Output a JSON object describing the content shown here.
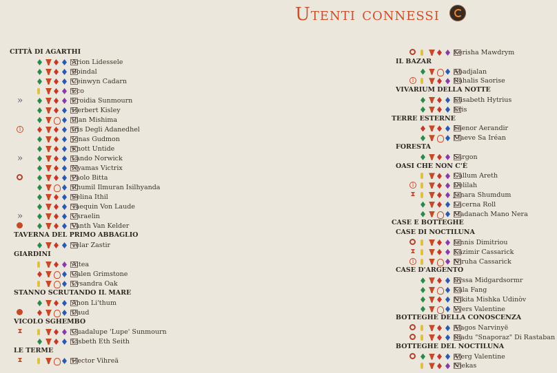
{
  "title": "Utenti connessi",
  "left": [
    {
      "location": "Città di Agarthi",
      "users": [
        {
          "name": "Arion Lidessele",
          "status": "",
          "icons": [
            "dgreen",
            "gob",
            "dred",
            "dblue"
          ]
        },
        {
          "name": "Boindal",
          "status": "",
          "icons": [
            "dgreen",
            "gob",
            "dred",
            "dblue"
          ]
        },
        {
          "name": "Ceinwyn Cadarn",
          "status": "",
          "icons": [
            "dgreen",
            "gob",
            "dred",
            "dblue"
          ]
        },
        {
          "name": "Eco",
          "status": "",
          "icons": [
            "dyellow",
            "gob",
            "dred",
            "dpurple"
          ]
        },
        {
          "name": "Eroidia Sunmourn",
          "status": "raquo",
          "icons": [
            "dgreen",
            "gob",
            "dred",
            "dpurple"
          ]
        },
        {
          "name": "Herbert Kisley",
          "status": "",
          "icons": [
            "dgreen",
            "gob",
            "dred",
            "dblue"
          ]
        },
        {
          "name": "Ilian Mishima",
          "status": "",
          "icons": [
            "dgreen",
            "gob",
            "dmg",
            "dblue"
          ]
        },
        {
          "name": "Iris Degli Adanedhel",
          "status": "info",
          "icons": [
            "dred",
            "gob",
            "dred",
            "dblue"
          ]
        },
        {
          "name": "Jonas Gudmon",
          "status": "",
          "icons": [
            "dgreen",
            "gob",
            "dred",
            "dblue"
          ]
        },
        {
          "name": "Knott Untide",
          "status": "",
          "icons": [
            "dgreen",
            "gob",
            "dred",
            "dblue"
          ]
        },
        {
          "name": "Lando Norwick",
          "status": "raquo",
          "icons": [
            "dgreen",
            "gob",
            "dred",
            "dblue"
          ]
        },
        {
          "name": "Nyamas Victrix",
          "status": "",
          "icons": [
            "dgreen",
            "gob",
            "dred",
            "dblue"
          ]
        },
        {
          "name": "Paolo Bitta",
          "status": "ring",
          "icons": [
            "dgreen",
            "gob",
            "dred",
            "dblue"
          ]
        },
        {
          "name": "Rhumil Ilmuran Isilhyanda",
          "status": "",
          "icons": [
            "dgreen",
            "gob",
            "dmg",
            "dblue"
          ]
        },
        {
          "name": "Selina Ithil",
          "status": "",
          "icons": [
            "dgreen",
            "gob",
            "dred",
            "dblue"
          ]
        },
        {
          "name": "Taequin Von Laude",
          "status": "",
          "icons": [
            "dgreen",
            "gob",
            "dred",
            "dblue"
          ]
        },
        {
          "name": "Usraelin",
          "status": "raquo",
          "icons": [
            "dgreen",
            "gob",
            "dred",
            "dblue"
          ]
        },
        {
          "name": "Vanth Van Kelder",
          "status": "red",
          "icons": [
            "dgreen",
            "gob",
            "dred",
            "dblue"
          ]
        }
      ]
    },
    {
      "location": "Taverna del Primo Abbaglio",
      "users": [
        {
          "name": "Telar Zastir",
          "status": "",
          "icons": [
            "dgreen",
            "gob",
            "dred",
            "dblue"
          ]
        }
      ]
    },
    {
      "location": "Giardini",
      "users": [
        {
          "name": "Altea",
          "status": "",
          "icons": [
            "dyellow",
            "gob",
            "dred",
            "dpurple"
          ]
        },
        {
          "name": "Galen Grimstone",
          "status": "",
          "icons": [
            "dred",
            "gob",
            "dmg",
            "dblue"
          ]
        },
        {
          "name": "Lysandra Oak",
          "status": "",
          "icons": [
            "dyellow",
            "gob",
            "dmg",
            "dblue"
          ]
        }
      ]
    },
    {
      "location": "Stanno scrutando il mare",
      "users": [
        {
          "name": "Anon Li'thum",
          "status": "",
          "icons": [
            "dgreen",
            "gob",
            "dred",
            "dblue"
          ]
        },
        {
          "name": "Daud",
          "status": "red",
          "icons": [
            "dred",
            "gob",
            "dmg",
            "dblue"
          ]
        }
      ]
    },
    {
      "location": "Vicolo Sghembo",
      "users": [
        {
          "name": "Guadalupe 'Lupe' Sunmourn",
          "status": "hg",
          "icons": [
            "dyellow",
            "gob",
            "dred",
            "dpurple"
          ]
        },
        {
          "name": "Lisbeth Eth Seith",
          "status": "",
          "icons": [
            "dgreen",
            "gob",
            "dred",
            "dblue"
          ]
        }
      ]
    },
    {
      "location": "Le Terme",
      "users": [
        {
          "name": "Hector Vihreä",
          "status": "hg",
          "icons": [
            "dyellow",
            "gob",
            "dmg",
            "dblue"
          ]
        }
      ]
    }
  ],
  "right": [
    {
      "location": "",
      "users": [
        {
          "name": "Kerisha Mawdrym",
          "status": "ring",
          "icons": [
            "dyellow",
            "gob",
            "dred",
            "dpurple"
          ]
        }
      ]
    },
    {
      "location": "Il Bazar",
      "users": [
        {
          "name": "Abadjalan",
          "status": "",
          "icons": [
            "dgreen",
            "gob",
            "dmg",
            "dblue"
          ]
        },
        {
          "name": "Rahalis Saorise",
          "status": "info",
          "icons": [
            "dyellow",
            "gob",
            "dred",
            "dpurple"
          ]
        }
      ]
    },
    {
      "location": "Vivarium della Notte",
      "users": [
        {
          "name": "Elisabeth Hytrius",
          "status": "",
          "icons": [
            "dgreen",
            "gob",
            "dred",
            "dblue"
          ]
        },
        {
          "name": "Eris",
          "status": "",
          "icons": [
            "dgreen",
            "gob",
            "dred",
            "dblue"
          ]
        }
      ]
    },
    {
      "location": "Terre Esterne",
      "users": [
        {
          "name": "Faenor Aerandir",
          "status": "",
          "icons": [
            "dred",
            "gob",
            "dred",
            "dblue"
          ]
        },
        {
          "name": "Maeve Sa Iréan",
          "status": "",
          "icons": [
            "dgreen",
            "gob",
            "dmg",
            "dblue"
          ]
        }
      ]
    },
    {
      "location": "Foresta",
      "users": [
        {
          "name": "Sargon",
          "status": "",
          "icons": [
            "dgreen",
            "gob",
            "dred",
            "dpurple"
          ]
        }
      ]
    },
    {
      "location": "Oasi che non c'è",
      "users": [
        {
          "name": "Callum Areth",
          "status": "",
          "icons": [
            "dyellow",
            "gob",
            "dred",
            "dpurple"
          ]
        },
        {
          "name": "Delilah",
          "status": "info",
          "icons": [
            "dyellow",
            "gob",
            "dred",
            "dpurple"
          ]
        },
        {
          "name": "Janara Shumdum",
          "status": "hg",
          "icons": [
            "dyellow",
            "gob",
            "dred",
            "dpurple"
          ]
        },
        {
          "name": "Lacerna Roll",
          "status": "",
          "icons": [
            "dgreen",
            "gob",
            "dred",
            "dblue"
          ]
        },
        {
          "name": "Madanach Mano Nera",
          "status": "",
          "icons": [
            "dgreen",
            "gob",
            "dmg",
            "dblue"
          ]
        }
      ]
    },
    {
      "location": "Case e Botteghe",
      "users": []
    },
    {
      "location": "Case di Noctiluna",
      "users": [
        {
          "name": "Iannis Dimitriou",
          "status": "ring",
          "icons": [
            "dyellow",
            "gob",
            "dred",
            "dpurple"
          ]
        },
        {
          "name": "Kazimir Cassarick",
          "status": "hg",
          "icons": [
            "dyellow",
            "gob",
            "dred",
            "dpurple"
          ]
        },
        {
          "name": "Niruha Cassarick",
          "status": "info",
          "icons": [
            "dyellow",
            "gob",
            "dmg",
            "dpurple"
          ]
        }
      ]
    },
    {
      "location": "Case d'Argento",
      "users": [
        {
          "name": "Ilyssa Midgardsormr",
          "status": "",
          "icons": [
            "dgreen",
            "gob",
            "dred",
            "dblue"
          ]
        },
        {
          "name": "Kala Fang",
          "status": "",
          "icons": [
            "dgreen",
            "gob",
            "dmg",
            "dblue"
          ]
        },
        {
          "name": "Nikita Mishka Udinòv",
          "status": "",
          "icons": [
            "dgreen",
            "gob",
            "dred",
            "dblue"
          ]
        },
        {
          "name": "Vyers Valentine",
          "status": "",
          "icons": [
            "dgreen",
            "gob",
            "dmg",
            "dblue"
          ]
        }
      ]
    },
    {
      "location": "Botteghe della Conoscenza",
      "users": [
        {
          "name": "Alagos Narvinyë",
          "status": "ring",
          "icons": [
            "dyellow",
            "gob",
            "dred",
            "dblue"
          ]
        },
        {
          "name": "Riadu \"Snaporaz\" Di Rastaban",
          "status": "ring",
          "icons": [
            "dyellow",
            "gob",
            "dred",
            "dblue"
          ]
        }
      ]
    },
    {
      "location": "Botteghe del Noctiluna",
      "users": [
        {
          "name": "Aterg Valentine",
          "status": "ring",
          "icons": [
            "dgreen",
            "gob",
            "dred",
            "dblue"
          ]
        },
        {
          "name": "Niekas",
          "status": "",
          "icons": [
            "dyellow",
            "gob",
            "dred",
            "dpurple"
          ]
        }
      ]
    }
  ]
}
